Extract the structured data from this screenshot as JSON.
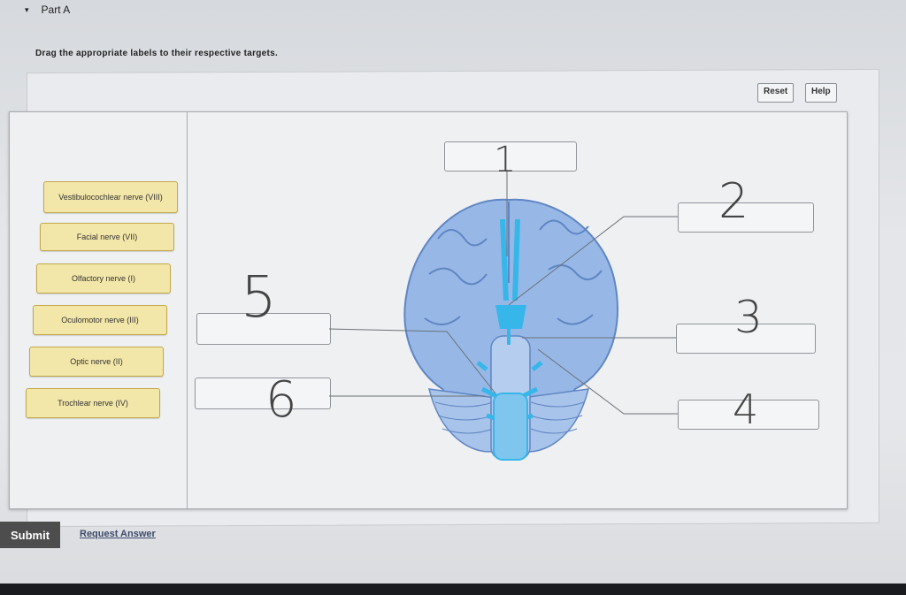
{
  "part": {
    "caret": "▾",
    "title": "Part A"
  },
  "instructions": "Drag the appropriate labels to their respective targets.",
  "toolbar": {
    "reset": "Reset",
    "help": "Help"
  },
  "labels": [
    "Vestibulocochlear nerve (VIII)",
    "Facial nerve (VII)",
    "Olfactory nerve (I)",
    "Oculomotor nerve (III)",
    "Optic nerve (II)",
    "Trochlear nerve (IV)"
  ],
  "handwritten": {
    "n1": "1",
    "n2": "2",
    "n3": "3",
    "n4": "4",
    "n5": "5",
    "n6": "6"
  },
  "footer": {
    "submit": "Submit",
    "request": "Request Answer"
  },
  "colors": {
    "label_fill": "#f2e6a8",
    "brain": "#8fb3e2",
    "nerves": "#37b6ea"
  }
}
